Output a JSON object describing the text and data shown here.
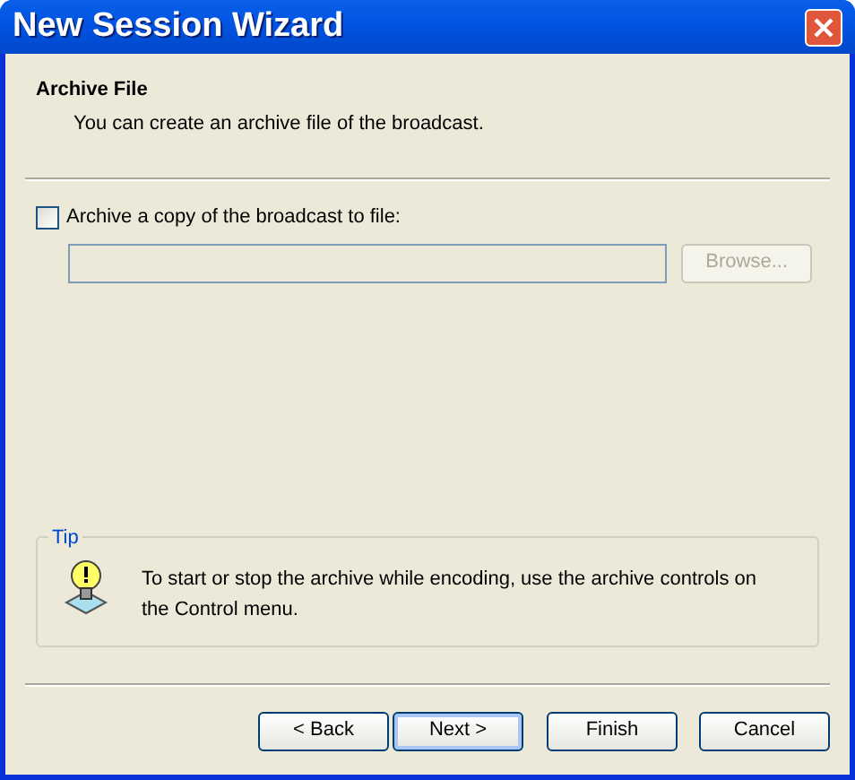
{
  "window": {
    "title": "New Session Wizard"
  },
  "header": {
    "title": "Archive File",
    "subtitle": "You can create an archive file of the broadcast."
  },
  "archive": {
    "label": "Archive a copy of the broadcast to file:",
    "checked": false,
    "path_field": {
      "disabled": true
    },
    "browse": {
      "label": "Browse...",
      "disabled": true
    }
  },
  "tip": {
    "legend": "Tip",
    "text": "To start or stop the archive while encoding, use the archive controls on the Control menu."
  },
  "buttons": [
    {
      "label": "< Back",
      "default": false
    },
    {
      "label": "Next >",
      "default": true
    },
    {
      "label": "Finish",
      "default": false
    },
    {
      "label": "Cancel",
      "default": false
    }
  ]
}
